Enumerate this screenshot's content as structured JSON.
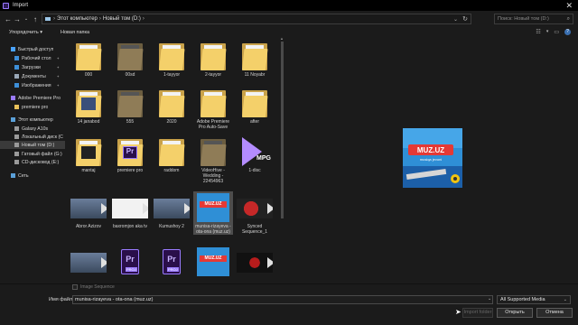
{
  "window": {
    "title": "Import",
    "close_glyph": "✕"
  },
  "address": {
    "crumbs": [
      "Этот компьютер",
      "Новый том (D:)"
    ],
    "search_placeholder": "Поиск: Новый том (D:)"
  },
  "toolbar": {
    "organize": "Упорядочить ▾",
    "new_folder": "Новая папка"
  },
  "nav": [
    {
      "label": "Быстрый доступ",
      "icon": "star-icon",
      "color": "#4aa3ff",
      "pinned": false
    },
    {
      "label": "Рабочий стол",
      "icon": "desktop-icon",
      "color": "#3d8fd8",
      "pinned": true
    },
    {
      "label": "Загрузки",
      "icon": "download-icon",
      "color": "#3d8fd8",
      "pinned": true
    },
    {
      "label": "Документы",
      "icon": "documents-icon",
      "color": "#9aa8b8",
      "pinned": true
    },
    {
      "label": "Изображения",
      "icon": "pictures-icon",
      "color": "#3d8fd8",
      "pinned": true
    },
    {
      "label": "Adobe Premiere Pro",
      "icon": "premiere-icon",
      "color": "#9a7bff",
      "pinned": false
    },
    {
      "label": "premiere pro",
      "icon": "folder-icon",
      "color": "#e8c15a",
      "pinned": false
    },
    {
      "label": "Этот компьютер",
      "icon": "computer-icon",
      "color": "#5aa0d8",
      "pinned": false
    },
    {
      "label": "Galaxy A10s",
      "icon": "phone-icon",
      "color": "#9a9a9a",
      "pinned": false
    },
    {
      "label": "Локальный диск (C",
      "icon": "drive-icon",
      "color": "#9a9a9a",
      "pinned": false
    },
    {
      "label": "Новый том (D:)",
      "icon": "drive-icon",
      "color": "#9a9a9a",
      "pinned": false,
      "selected": true
    },
    {
      "label": "Гатовый файл (G:)",
      "icon": "drive-icon",
      "color": "#9a9a9a",
      "pinned": false
    },
    {
      "label": "CD-дисковод (E:)",
      "icon": "cd-icon",
      "color": "#9a9a9a",
      "pinned": false
    },
    {
      "label": "Сеть",
      "icon": "network-icon",
      "color": "#5aa0d8",
      "pinned": false
    }
  ],
  "items": [
    {
      "name": "000",
      "kind": "folder"
    },
    {
      "name": "00sd",
      "kind": "folder-dark"
    },
    {
      "name": "1-tayyor",
      "kind": "folder"
    },
    {
      "name": "2-tayyor",
      "kind": "folder"
    },
    {
      "name": "11 Noyabr",
      "kind": "folder"
    },
    {
      "name": "14 janabod",
      "kind": "folder-video"
    },
    {
      "name": "555",
      "kind": "folder-dark"
    },
    {
      "name": "2020",
      "kind": "folder"
    },
    {
      "name": "Adobe Premiere Pro Auto-Save",
      "kind": "folder"
    },
    {
      "name": "after",
      "kind": "folder"
    },
    {
      "name": "mantaj",
      "kind": "folder-doc"
    },
    {
      "name": "premiere pro",
      "kind": "folder-pr"
    },
    {
      "name": "raddom",
      "kind": "folder"
    },
    {
      "name": "VideoHive - Wedding - 22454963",
      "kind": "folder-dark"
    },
    {
      "name": "1-disc",
      "kind": "mpg"
    },
    {
      "name": "Abror Azizov",
      "kind": "video"
    },
    {
      "name": "baxromjon aka tv",
      "kind": "video-white"
    },
    {
      "name": "Kumushoy 2",
      "kind": "video"
    },
    {
      "name": "munisa-rizayeva - ota-ona (muz.uz)",
      "kind": "image-muz",
      "selected": true
    },
    {
      "name": "Synced Sequence_1",
      "kind": "video-red"
    },
    {
      "name": "",
      "kind": "video"
    },
    {
      "name": "",
      "kind": "proj"
    },
    {
      "name": "",
      "kind": "proj"
    },
    {
      "name": "",
      "kind": "image-muz"
    },
    {
      "name": "",
      "kind": "video-dark"
    }
  ],
  "mpg_label": "MPG",
  "proj_label": "PROJ",
  "pr_label": "Pr",
  "muz": {
    "brand": "MUZ.UZ",
    "tagline": "musiqa jevoni"
  },
  "image_sequence": "Image Sequence",
  "filename_label": "Имя файла:",
  "filename_value": "munisa-rizayeva - ota-ona (muz.uz)",
  "filetype": "All Supported Media",
  "buttons": {
    "import_folder": "Import folder",
    "open": "Открыть",
    "cancel": "Отмена"
  }
}
